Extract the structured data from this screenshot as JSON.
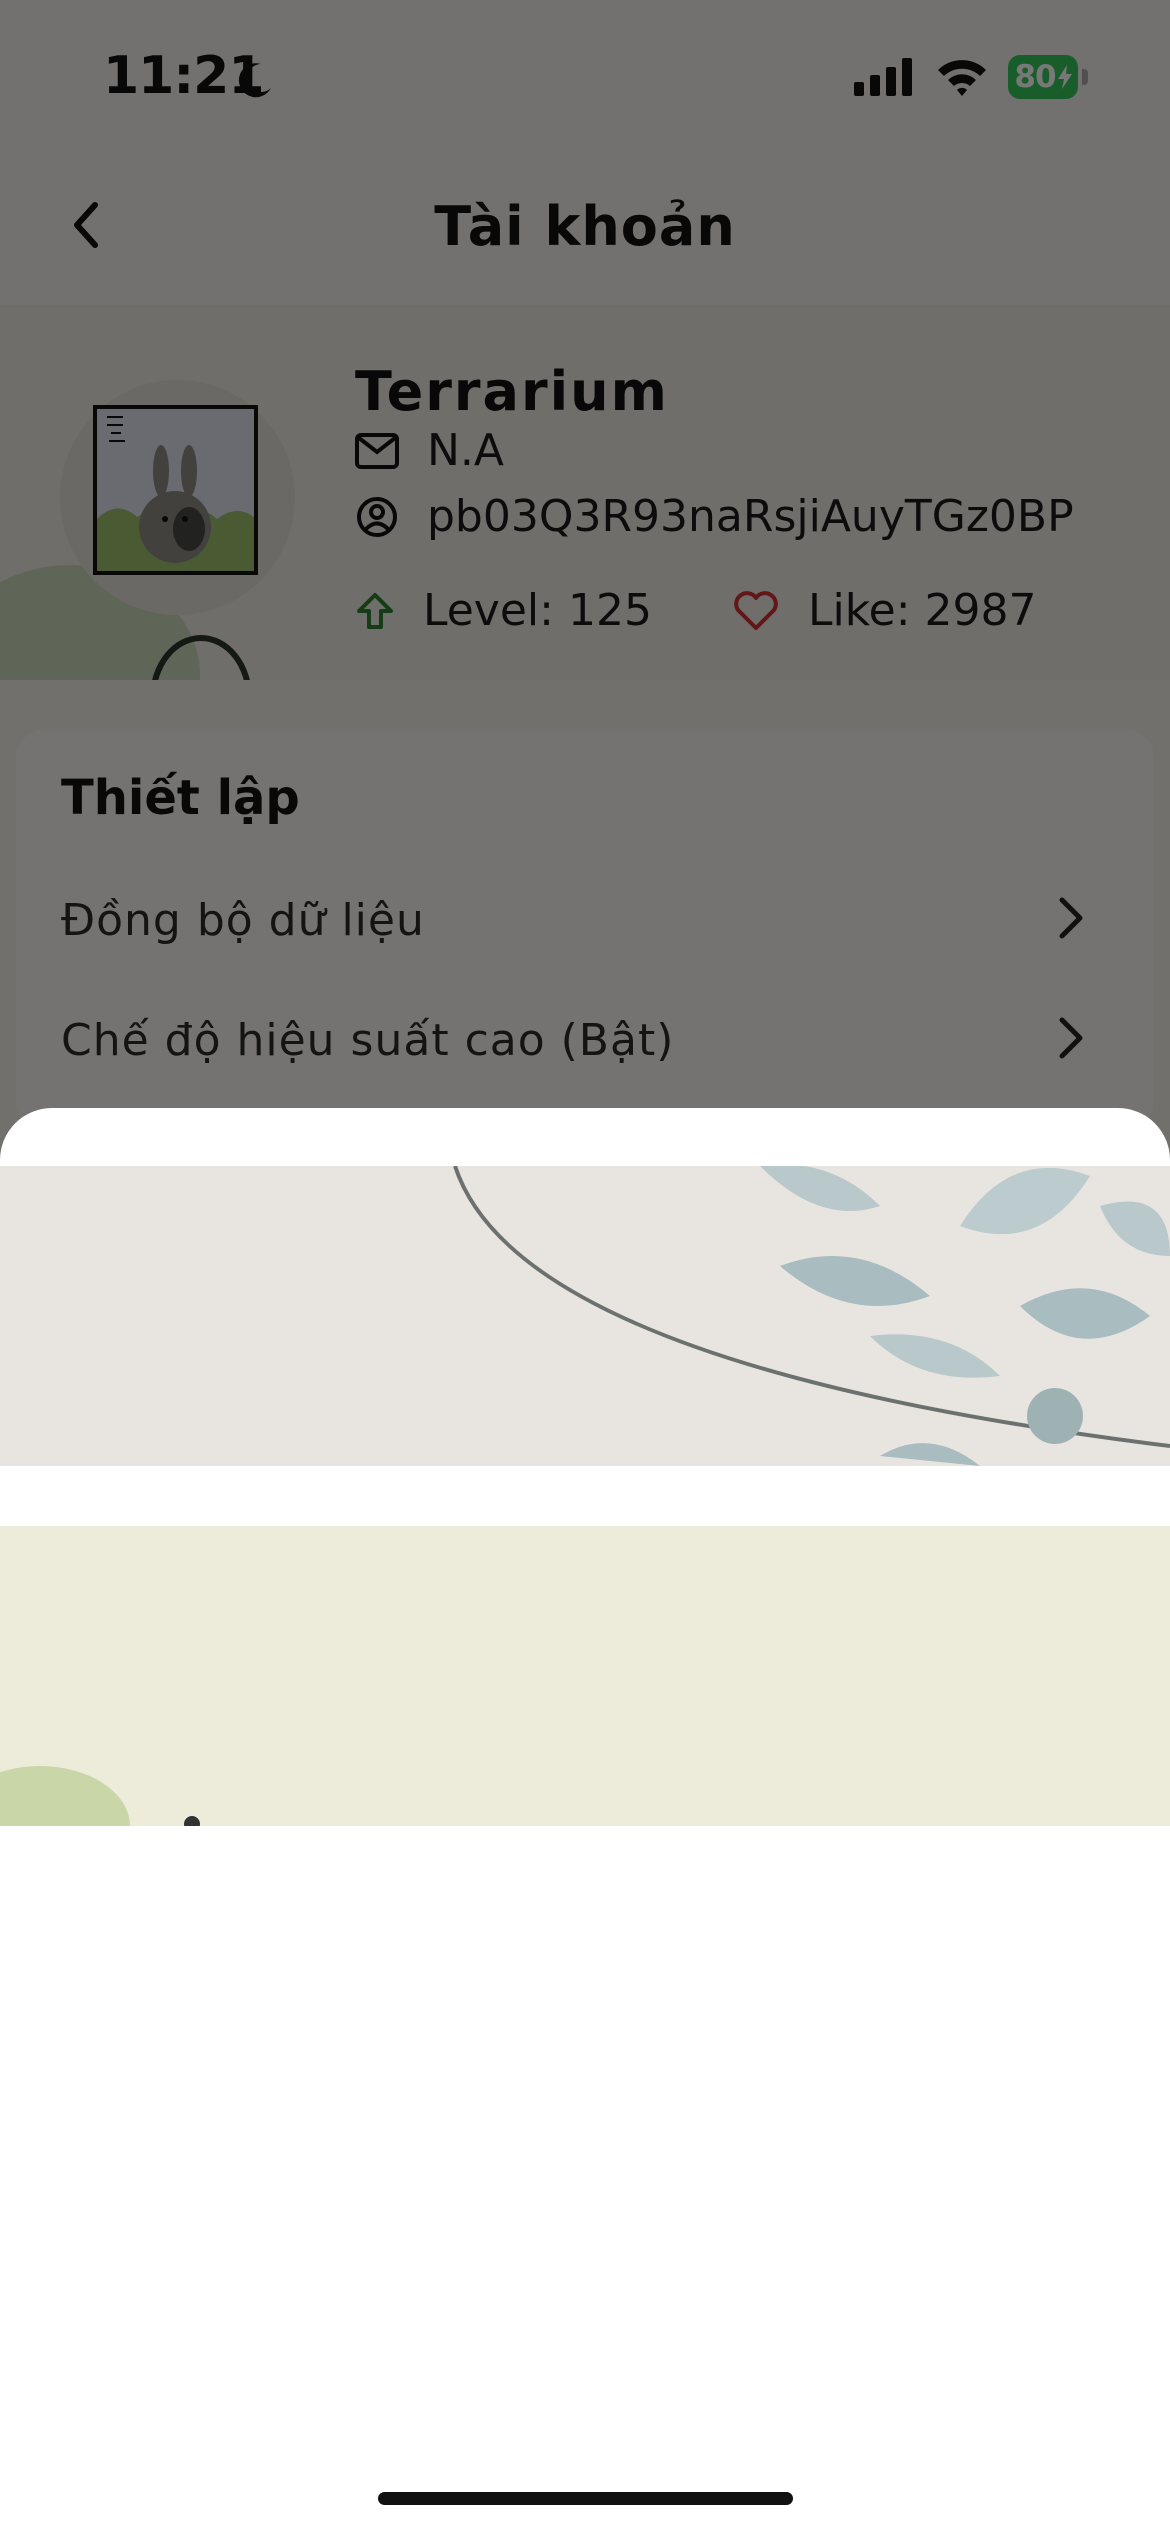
{
  "status_bar": {
    "time": "11:21",
    "battery": "80",
    "icons": [
      "moon-icon",
      "cellular-signal-icon",
      "wifi-icon",
      "battery-charging-icon"
    ],
    "battery_color": "#36c759"
  },
  "header": {
    "title": "Tài khoản",
    "back_icon": "chevron-left-icon"
  },
  "profile": {
    "name": "Terrarium",
    "email": "N.A",
    "user_id": "pb03Q3R93naRsjiAuyTGz0BP",
    "level": "Level: 125",
    "likes": "Like: 2987",
    "level_icon_color": "#2e7d32",
    "like_icon_color": "#d32f2f"
  },
  "settings": {
    "title": "Thiết lập",
    "items": [
      {
        "label": "Đồng bộ dữ liệu"
      },
      {
        "label": "Chế độ hiệu suất cao (Bật)"
      }
    ]
  },
  "sheet": {
    "banners": [
      "banner-leaf-blue",
      "banner-leaf-green"
    ]
  }
}
